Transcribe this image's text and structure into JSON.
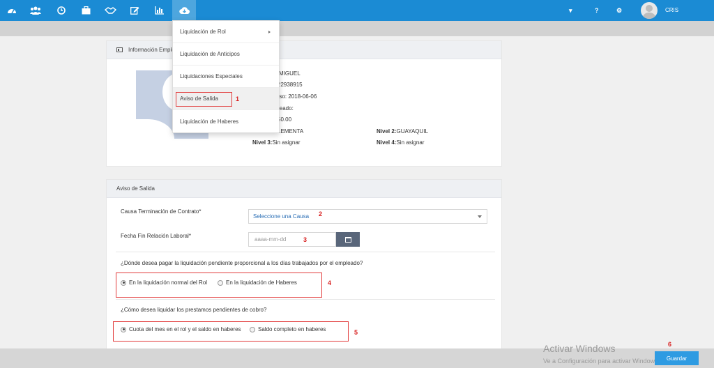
{
  "navbar": {
    "icons": [
      "dashboard-icon",
      "users-icon",
      "clock-icon",
      "briefcase-icon",
      "handshake-icon",
      "edit-icon",
      "bar-chart-icon",
      "cloud-download-icon"
    ],
    "right": {
      "caret": "▾",
      "help": "?",
      "settings": "⚙"
    },
    "user_name": "CRIS"
  },
  "dropdown": {
    "items": [
      {
        "label": "Liquidación de Rol",
        "has_submenu": true
      },
      {
        "label": "Liquidación de Anticipos"
      },
      {
        "label": "Liquidaciones Especiales"
      },
      {
        "label": "Aviso de Salida"
      },
      {
        "label": "Liquidación de Haberes"
      }
    ]
  },
  "info_panel": {
    "title": "Información Emple",
    "lines": {
      "name": "MIGUEL",
      "id": "22938915",
      "ingreso": "eso: 2018-06-06",
      "empleado": "leado:",
      "salary": "50.00",
      "nivel1": "LEMENTA",
      "nivel2_label": "Nivel 2:",
      "nivel2_value": "GUAYAQUIL",
      "nivel3_label": "Nivel 3:",
      "nivel3_value": "Sin asignar",
      "nivel4_label": "Nivel 4:",
      "nivel4_value": "Sin asignar"
    }
  },
  "aviso_panel": {
    "title": "Aviso de Salida",
    "causa_label": "Causa Terminación de Contrato*",
    "causa_select": "Seleccione una Causa",
    "fecha_label": "Fecha Fin Relación Laboral*",
    "fecha_placeholder": "aaaa-mm-dd",
    "q1": "¿Dónde desea pagar la liquidación pendiente proporcional a los días trabajados por el empleado?",
    "q1_opt1": "En la liquidación normal del Rol",
    "q1_opt2": "En la liquidación de Haberes",
    "q2": "¿Cómo desea liquidar los prestamos pendientes de cobro?",
    "q2_opt1": "Cuota del mes en el rol y el saldo en haberes",
    "q2_opt2": "Saldo completo en haberes"
  },
  "markers": [
    "1",
    "2",
    "3",
    "4",
    "5",
    "6"
  ],
  "footer": {
    "save_label": "Guardar",
    "watermark_title": "Activar Windows",
    "watermark_sub": "Ve a Configuración para activar Windows."
  },
  "colors": {
    "navbar": "#1b8bd4",
    "save_button": "#2e9be2",
    "marker": "#d81f1f"
  }
}
